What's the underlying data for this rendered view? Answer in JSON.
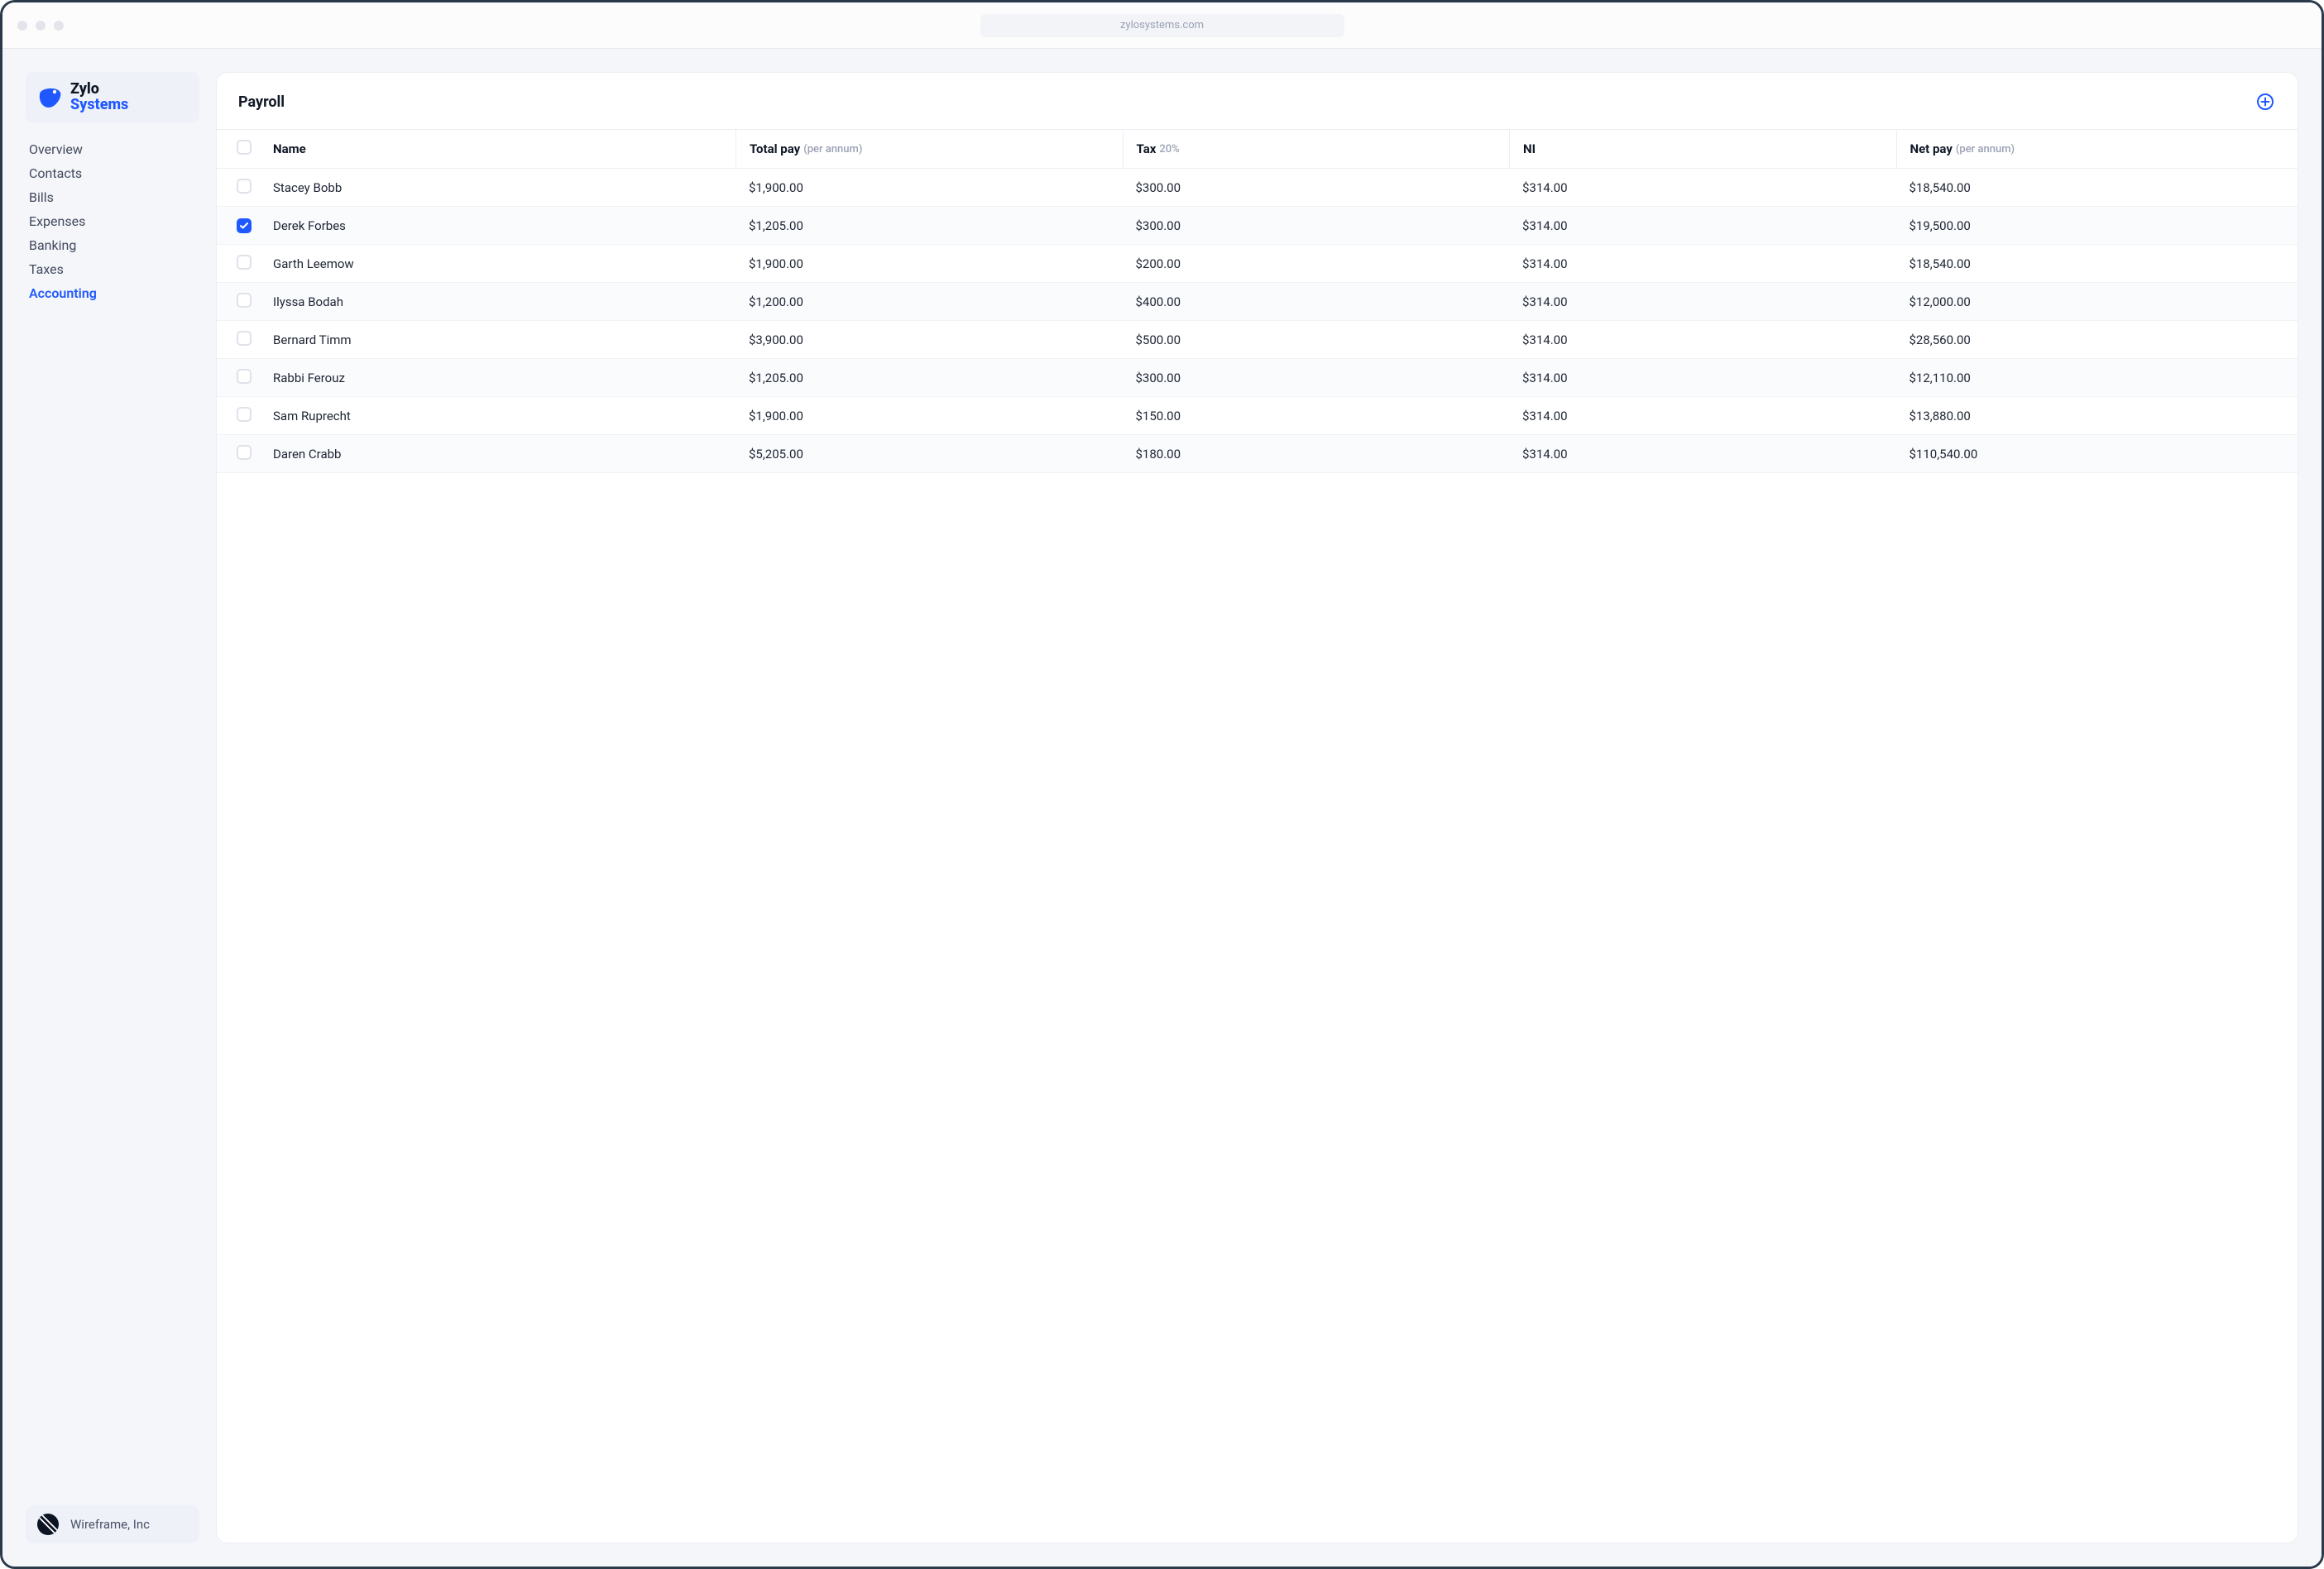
{
  "chrome": {
    "address": "zylosystems.com"
  },
  "brand": {
    "line1": "Zylo",
    "line2": "Systems"
  },
  "nav": {
    "items": [
      {
        "label": "Overview",
        "active": false
      },
      {
        "label": "Contacts",
        "active": false
      },
      {
        "label": "Bills",
        "active": false
      },
      {
        "label": "Expenses",
        "active": false
      },
      {
        "label": "Banking",
        "active": false
      },
      {
        "label": "Taxes",
        "active": false
      },
      {
        "label": "Accounting",
        "active": true
      }
    ]
  },
  "account": {
    "name": "Wireframe, Inc"
  },
  "panel": {
    "title": "Payroll",
    "columns": {
      "name": {
        "label": "Name"
      },
      "total": {
        "label": "Total pay",
        "sub": "(per annum)"
      },
      "tax": {
        "label": "Tax",
        "sub": "20%"
      },
      "ni": {
        "label": "NI"
      },
      "net": {
        "label": "Net pay",
        "sub": "(per annum)"
      }
    },
    "rows": [
      {
        "checked": false,
        "name": "Stacey Bobb",
        "total": "$1,900.00",
        "tax": "$300.00",
        "ni": "$314.00",
        "net": "$18,540.00"
      },
      {
        "checked": true,
        "name": "Derek Forbes",
        "total": "$1,205.00",
        "tax": "$300.00",
        "ni": "$314.00",
        "net": "$19,500.00"
      },
      {
        "checked": false,
        "name": "Garth Leemow",
        "total": "$1,900.00",
        "tax": "$200.00",
        "ni": "$314.00",
        "net": "$18,540.00"
      },
      {
        "checked": false,
        "name": "Ilyssa Bodah",
        "total": "$1,200.00",
        "tax": "$400.00",
        "ni": "$314.00",
        "net": "$12,000.00"
      },
      {
        "checked": false,
        "name": "Bernard Timm",
        "total": "$3,900.00",
        "tax": "$500.00",
        "ni": "$314.00",
        "net": "$28,560.00"
      },
      {
        "checked": false,
        "name": "Rabbi Ferouz",
        "total": "$1,205.00",
        "tax": "$300.00",
        "ni": "$314.00",
        "net": "$12,110.00"
      },
      {
        "checked": false,
        "name": "Sam Ruprecht",
        "total": "$1,900.00",
        "tax": "$150.00",
        "ni": "$314.00",
        "net": "$13,880.00"
      },
      {
        "checked": false,
        "name": "Daren Crabb",
        "total": "$5,205.00",
        "tax": "$180.00",
        "ni": "$314.00",
        "net": "$110,540.00"
      }
    ]
  },
  "colors": {
    "accent": "#1f58ff"
  }
}
